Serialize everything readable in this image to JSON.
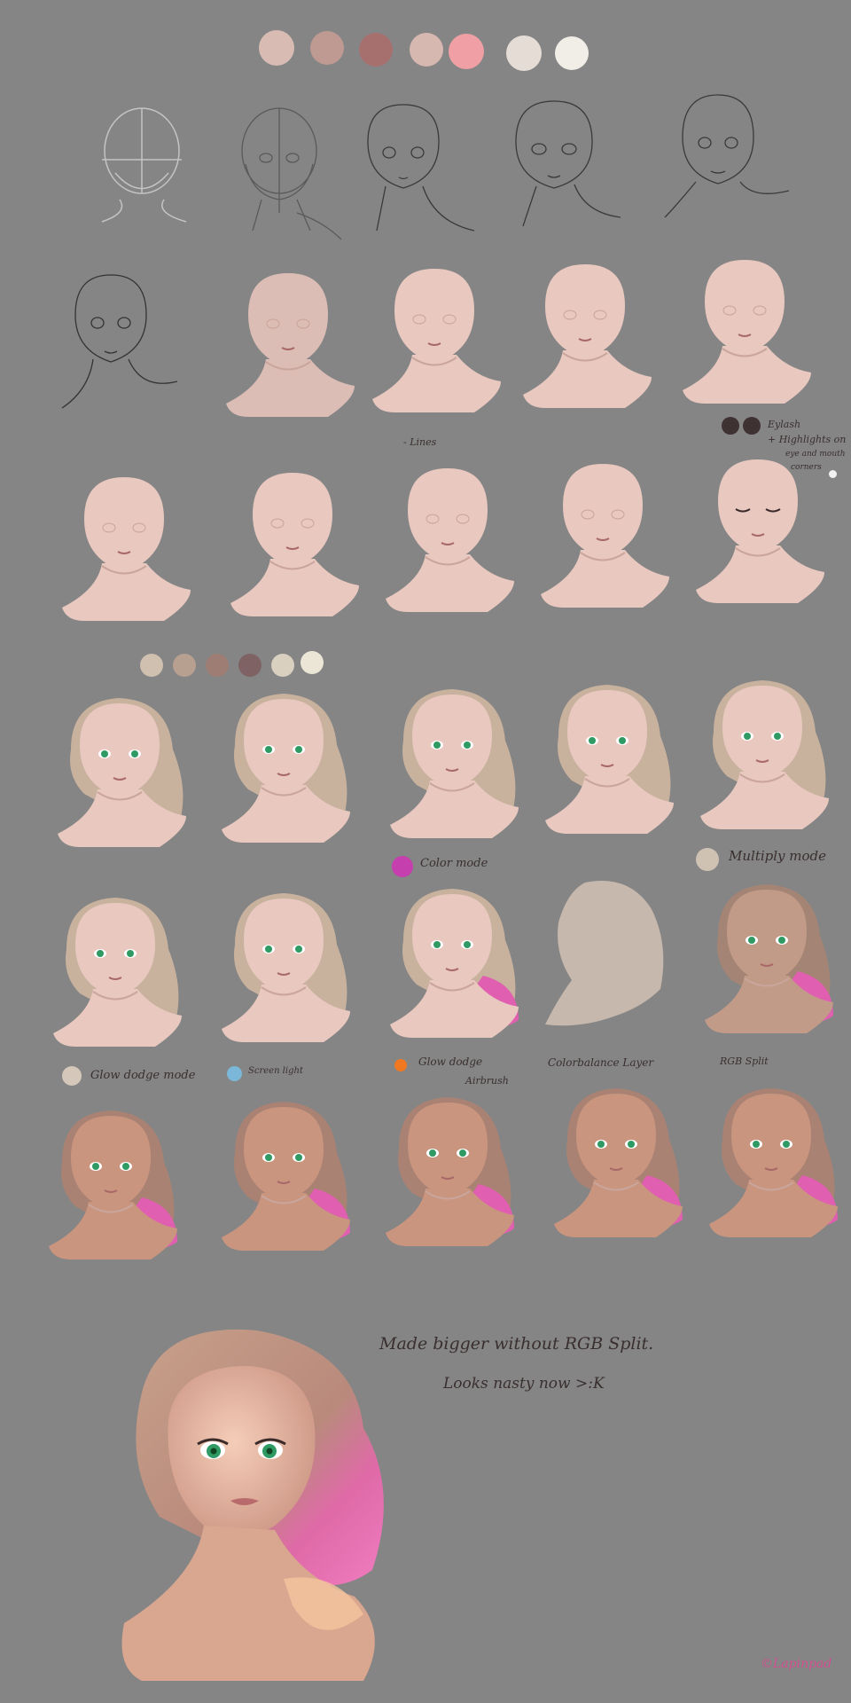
{
  "palettes": {
    "skin_top": [
      "#d8bcb4",
      "#bf9a92",
      "#a5706e",
      "#d6b8b0",
      "#f0a0a4",
      "#e6dcd6",
      "#f1eee8"
    ],
    "eyelash": [
      "#3f3232",
      "#3f3232"
    ],
    "highlight": [
      "#f2f2f2"
    ],
    "hair": [
      "#cfc0b0",
      "#b8a090",
      "#9e7e74",
      "#7e6264",
      "#d9d0c0",
      "#ece6d6"
    ]
  },
  "mode_swatches": {
    "color_mode": "#c53fae",
    "multiply_mode": "#cfc2b3",
    "glow_dodge_mode": "#d5c7ba",
    "screen_light": "#7ab7d8",
    "glow_dodge_airbrush": "#f07820"
  },
  "notes": {
    "lines": "- Lines",
    "eyelash_1": "Eylash",
    "eyelash_2": "+ Highlights on",
    "eyelash_3": "eye and mouth",
    "eyelash_4": "corners",
    "color_mode": "Color mode",
    "multiply_mode": "Multiply mode",
    "glow_dodge_mode": "Glow dodge mode",
    "screen_light": "Screen light",
    "glow_dodge_airbrush_1": "Glow dodge",
    "glow_dodge_airbrush_2": "Airbrush",
    "colorbalance": "Colorbalance Layer",
    "rgb_split": "RGB Split",
    "final_1": "Made bigger without RGB Split.",
    "final_2": "Looks nasty now >:K",
    "signature": "©Lapinpad"
  },
  "colors": {
    "background": "#858585",
    "ink": "#3a2f2f",
    "skin": "#e8c8bf",
    "skin_shadow": "#c9a59c",
    "hair_blonde": "#c8b29e",
    "hair_pink": "#e05fb0",
    "eye": "#2f9a63"
  }
}
